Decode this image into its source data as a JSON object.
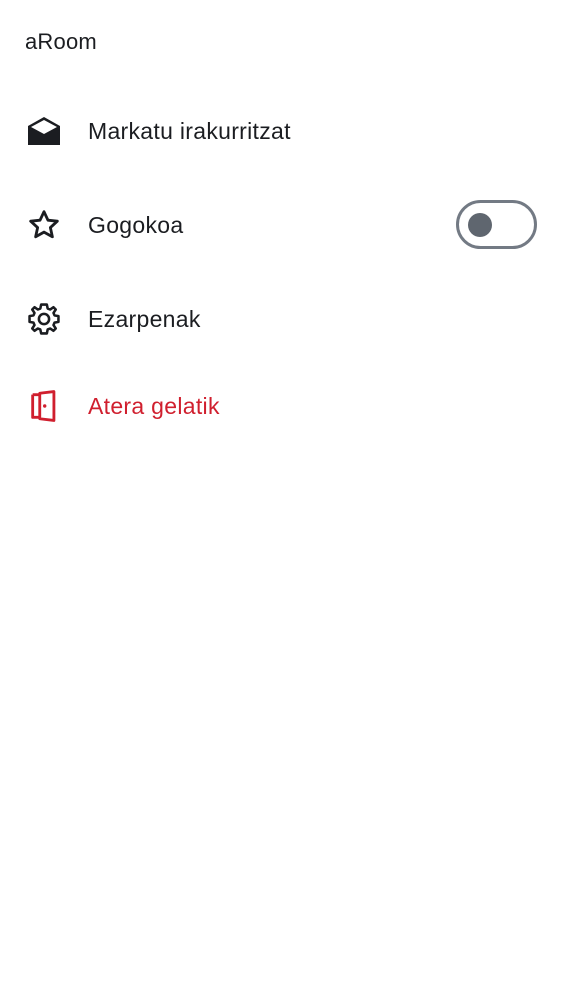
{
  "app": {
    "title": "aRoom"
  },
  "menu": {
    "items": [
      {
        "label": "Markatu irakurritzat",
        "icon": "envelope-open-icon"
      },
      {
        "label": "Gogokoa",
        "icon": "star-outline-icon",
        "toggle": false
      },
      {
        "label": "Ezarpenak",
        "icon": "gear-icon"
      },
      {
        "label": "Atera gelatik",
        "icon": "door-exit-icon"
      }
    ]
  },
  "colors": {
    "text": "#1b1d21",
    "danger": "#d01f2e",
    "toggle_border": "#737a84",
    "toggle_knob": "#5f666f"
  }
}
